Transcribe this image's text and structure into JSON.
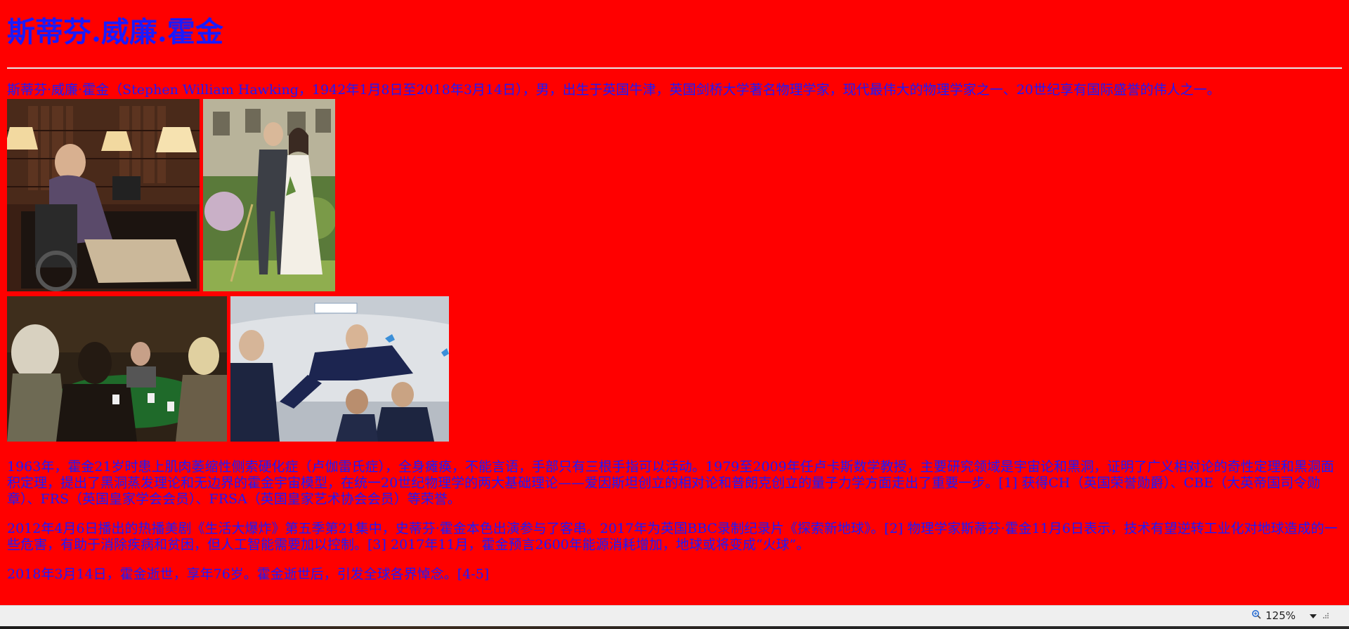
{
  "page": {
    "title": "斯蒂芬.威廉.霍金",
    "intro": "斯蒂芬·威廉·霍金（Stephen William Hawking，1942年1月8日至2018年3月14日），男，出生于英国牛津，英国剑桥大学著名物理学家，现代最伟大的物理学家之一、20世纪享有国际盛誉的伟人之一。",
    "paragraphs": [
      "1963年，霍金21岁时患上肌肉萎缩性侧索硬化症（卢伽雷氏症），全身瘫痪，不能言语，手部只有三根手指可以活动。1979至2009年任卢卡斯数学教授，主要研究领域是宇宙论和黑洞，证明了广义相对论的奇性定理和黑洞面积定理，提出了黑洞蒸发理论和无边界的霍金宇宙模型，在统一20世纪物理学的两大基础理论——爱因斯坦创立的相对论和普朗克创立的量子力学方面走出了重要一步。[1] 获得CH（英国荣誉勋爵）、CBE（大英帝国司令勋章）、FRS（英国皇家学会会员）、FRSA（英国皇家艺术协会会员）等荣誉。",
      "2012年4月6日播出的热播美剧《生活大爆炸》第五季第21集中，史蒂芬·霍金本色出演参与了客串。2017年为英国BBC录制纪录片《探索新地球》。[2] 物理学家斯蒂芬·霍金11月6日表示，技术有望逆转工业化对地球造成的一些危害，有助于消除疾病和贫困，但人工智能需要加以控制。[3] 2017年11月，霍金预言2600年能源消耗增加，地球或将变成“火球”。",
      "2018年3月14日，霍金逝世，享年76岁。霍金逝世后，引发全球各界悼念。[4-5]"
    ]
  },
  "statusbar": {
    "zoom": "125%"
  },
  "colors": {
    "background": "#ff0000",
    "text": "#1a1aff",
    "divider": "#e6e6e6",
    "statusbar": "#efefef"
  },
  "icons": {
    "zoom": "magnifier-icon",
    "dropdown": "chevron-down-icon"
  }
}
